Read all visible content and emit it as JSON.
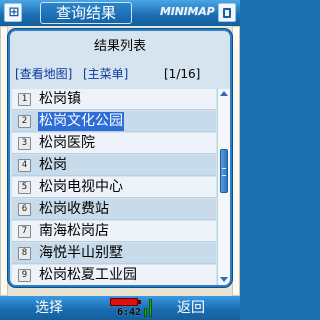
{
  "header": {
    "title": "查询结果",
    "brand": "MINIMAP"
  },
  "dialog": {
    "title": "结果列表",
    "view_map_link": "[查看地图]",
    "main_menu_link": "[主菜单]",
    "pager": "[1/16]",
    "items": [
      {
        "num": "1",
        "label": "松岗镇"
      },
      {
        "num": "2",
        "label": "松岗文化公园"
      },
      {
        "num": "3",
        "label": "松岗医院"
      },
      {
        "num": "4",
        "label": "松岗"
      },
      {
        "num": "5",
        "label": "松岗电视中心"
      },
      {
        "num": "6",
        "label": "松岗收费站"
      },
      {
        "num": "7",
        "label": "南海松岗店"
      },
      {
        "num": "8",
        "label": "海悦半山别墅"
      },
      {
        "num": "9",
        "label": "松岗松夏工业园"
      }
    ],
    "selected_index": 1
  },
  "footer": {
    "left_softkey": "选择",
    "right_softkey": "返回",
    "time": "6:42"
  },
  "icons": {
    "top_left": "app-icon",
    "top_right": "window-icon",
    "scroll_up": "arrow-up-icon",
    "scroll_down": "arrow-down-icon",
    "battery": "battery-icon",
    "signal": "signal-icon"
  },
  "colors": {
    "bar_blue": "#1a6cb0",
    "selection": "#2f6dd6",
    "row_light": "#edf3f8",
    "row_alt": "#c8dbea"
  }
}
